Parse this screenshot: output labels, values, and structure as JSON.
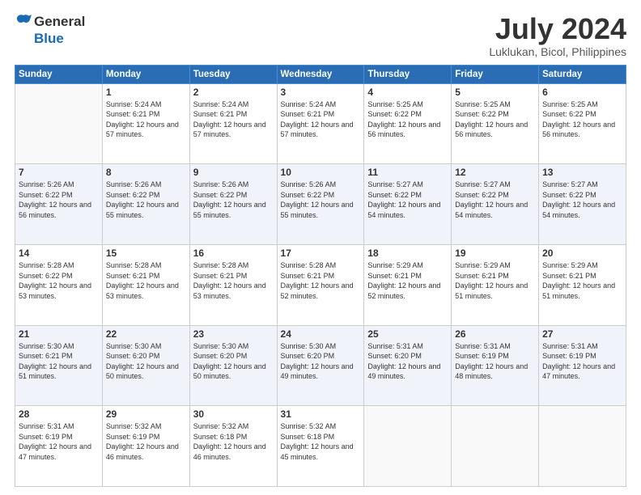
{
  "header": {
    "logo_line1": "General",
    "logo_line2": "Blue",
    "month_year": "July 2024",
    "location": "Luklukan, Bicol, Philippines"
  },
  "weekdays": [
    "Sunday",
    "Monday",
    "Tuesday",
    "Wednesday",
    "Thursday",
    "Friday",
    "Saturday"
  ],
  "weeks": [
    [
      {
        "day": "",
        "sunrise": "",
        "sunset": "",
        "daylight": ""
      },
      {
        "day": "1",
        "sunrise": "Sunrise: 5:24 AM",
        "sunset": "Sunset: 6:21 PM",
        "daylight": "Daylight: 12 hours and 57 minutes."
      },
      {
        "day": "2",
        "sunrise": "Sunrise: 5:24 AM",
        "sunset": "Sunset: 6:21 PM",
        "daylight": "Daylight: 12 hours and 57 minutes."
      },
      {
        "day": "3",
        "sunrise": "Sunrise: 5:24 AM",
        "sunset": "Sunset: 6:21 PM",
        "daylight": "Daylight: 12 hours and 57 minutes."
      },
      {
        "day": "4",
        "sunrise": "Sunrise: 5:25 AM",
        "sunset": "Sunset: 6:22 PM",
        "daylight": "Daylight: 12 hours and 56 minutes."
      },
      {
        "day": "5",
        "sunrise": "Sunrise: 5:25 AM",
        "sunset": "Sunset: 6:22 PM",
        "daylight": "Daylight: 12 hours and 56 minutes."
      },
      {
        "day": "6",
        "sunrise": "Sunrise: 5:25 AM",
        "sunset": "Sunset: 6:22 PM",
        "daylight": "Daylight: 12 hours and 56 minutes."
      }
    ],
    [
      {
        "day": "7",
        "sunrise": "Sunrise: 5:26 AM",
        "sunset": "Sunset: 6:22 PM",
        "daylight": "Daylight: 12 hours and 56 minutes."
      },
      {
        "day": "8",
        "sunrise": "Sunrise: 5:26 AM",
        "sunset": "Sunset: 6:22 PM",
        "daylight": "Daylight: 12 hours and 55 minutes."
      },
      {
        "day": "9",
        "sunrise": "Sunrise: 5:26 AM",
        "sunset": "Sunset: 6:22 PM",
        "daylight": "Daylight: 12 hours and 55 minutes."
      },
      {
        "day": "10",
        "sunrise": "Sunrise: 5:26 AM",
        "sunset": "Sunset: 6:22 PM",
        "daylight": "Daylight: 12 hours and 55 minutes."
      },
      {
        "day": "11",
        "sunrise": "Sunrise: 5:27 AM",
        "sunset": "Sunset: 6:22 PM",
        "daylight": "Daylight: 12 hours and 54 minutes."
      },
      {
        "day": "12",
        "sunrise": "Sunrise: 5:27 AM",
        "sunset": "Sunset: 6:22 PM",
        "daylight": "Daylight: 12 hours and 54 minutes."
      },
      {
        "day": "13",
        "sunrise": "Sunrise: 5:27 AM",
        "sunset": "Sunset: 6:22 PM",
        "daylight": "Daylight: 12 hours and 54 minutes."
      }
    ],
    [
      {
        "day": "14",
        "sunrise": "Sunrise: 5:28 AM",
        "sunset": "Sunset: 6:22 PM",
        "daylight": "Daylight: 12 hours and 53 minutes."
      },
      {
        "day": "15",
        "sunrise": "Sunrise: 5:28 AM",
        "sunset": "Sunset: 6:21 PM",
        "daylight": "Daylight: 12 hours and 53 minutes."
      },
      {
        "day": "16",
        "sunrise": "Sunrise: 5:28 AM",
        "sunset": "Sunset: 6:21 PM",
        "daylight": "Daylight: 12 hours and 53 minutes."
      },
      {
        "day": "17",
        "sunrise": "Sunrise: 5:28 AM",
        "sunset": "Sunset: 6:21 PM",
        "daylight": "Daylight: 12 hours and 52 minutes."
      },
      {
        "day": "18",
        "sunrise": "Sunrise: 5:29 AM",
        "sunset": "Sunset: 6:21 PM",
        "daylight": "Daylight: 12 hours and 52 minutes."
      },
      {
        "day": "19",
        "sunrise": "Sunrise: 5:29 AM",
        "sunset": "Sunset: 6:21 PM",
        "daylight": "Daylight: 12 hours and 51 minutes."
      },
      {
        "day": "20",
        "sunrise": "Sunrise: 5:29 AM",
        "sunset": "Sunset: 6:21 PM",
        "daylight": "Daylight: 12 hours and 51 minutes."
      }
    ],
    [
      {
        "day": "21",
        "sunrise": "Sunrise: 5:30 AM",
        "sunset": "Sunset: 6:21 PM",
        "daylight": "Daylight: 12 hours and 51 minutes."
      },
      {
        "day": "22",
        "sunrise": "Sunrise: 5:30 AM",
        "sunset": "Sunset: 6:20 PM",
        "daylight": "Daylight: 12 hours and 50 minutes."
      },
      {
        "day": "23",
        "sunrise": "Sunrise: 5:30 AM",
        "sunset": "Sunset: 6:20 PM",
        "daylight": "Daylight: 12 hours and 50 minutes."
      },
      {
        "day": "24",
        "sunrise": "Sunrise: 5:30 AM",
        "sunset": "Sunset: 6:20 PM",
        "daylight": "Daylight: 12 hours and 49 minutes."
      },
      {
        "day": "25",
        "sunrise": "Sunrise: 5:31 AM",
        "sunset": "Sunset: 6:20 PM",
        "daylight": "Daylight: 12 hours and 49 minutes."
      },
      {
        "day": "26",
        "sunrise": "Sunrise: 5:31 AM",
        "sunset": "Sunset: 6:19 PM",
        "daylight": "Daylight: 12 hours and 48 minutes."
      },
      {
        "day": "27",
        "sunrise": "Sunrise: 5:31 AM",
        "sunset": "Sunset: 6:19 PM",
        "daylight": "Daylight: 12 hours and 47 minutes."
      }
    ],
    [
      {
        "day": "28",
        "sunrise": "Sunrise: 5:31 AM",
        "sunset": "Sunset: 6:19 PM",
        "daylight": "Daylight: 12 hours and 47 minutes."
      },
      {
        "day": "29",
        "sunrise": "Sunrise: 5:32 AM",
        "sunset": "Sunset: 6:19 PM",
        "daylight": "Daylight: 12 hours and 46 minutes."
      },
      {
        "day": "30",
        "sunrise": "Sunrise: 5:32 AM",
        "sunset": "Sunset: 6:18 PM",
        "daylight": "Daylight: 12 hours and 46 minutes."
      },
      {
        "day": "31",
        "sunrise": "Sunrise: 5:32 AM",
        "sunset": "Sunset: 6:18 PM",
        "daylight": "Daylight: 12 hours and 45 minutes."
      },
      {
        "day": "",
        "sunrise": "",
        "sunset": "",
        "daylight": ""
      },
      {
        "day": "",
        "sunrise": "",
        "sunset": "",
        "daylight": ""
      },
      {
        "day": "",
        "sunrise": "",
        "sunset": "",
        "daylight": ""
      }
    ]
  ]
}
